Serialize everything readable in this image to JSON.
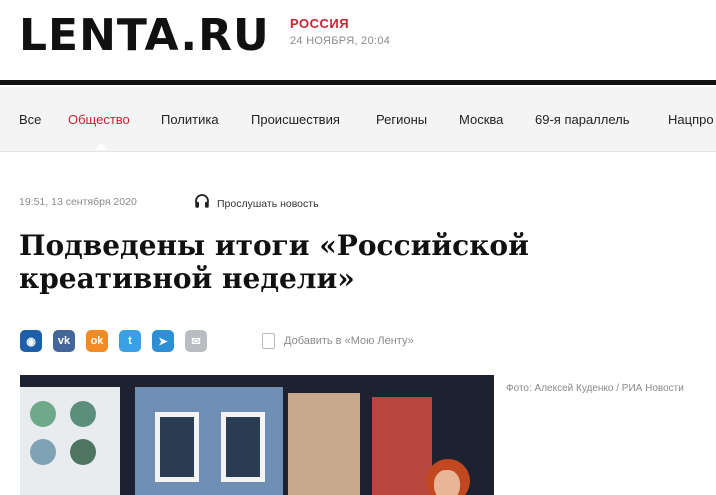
{
  "header": {
    "logo": "LENTA.RU",
    "rubric": "РОССИЯ",
    "datetime": "24 НОЯБРЯ, 20:04"
  },
  "nav": {
    "items": [
      {
        "label": "Все",
        "active": false
      },
      {
        "label": "Общество",
        "active": true
      },
      {
        "label": "Политика",
        "active": false
      },
      {
        "label": "Происшествия",
        "active": false
      },
      {
        "label": "Регионы",
        "active": false
      },
      {
        "label": "Москва",
        "active": false
      },
      {
        "label": "69-я параллель",
        "active": false
      },
      {
        "label": "Нацпро",
        "active": false
      }
    ]
  },
  "article": {
    "published": "19:51, 13 сентября 2020",
    "listen_label": "Прослушать новость",
    "title": "Подведены итоги «Российской креативной недели»",
    "add_to_feed_label": "Добавить в «Мою Ленту»",
    "photo_caption": "Фото: Алексей Куденко / РИА Новости"
  },
  "share_buttons": [
    {
      "name": "odnoklassniki-circle",
      "icon": "circle-icon",
      "glyph": "◉",
      "color": "#1d5fa8"
    },
    {
      "name": "vk",
      "icon": "vk-icon",
      "glyph": "vk",
      "color": "#44679a"
    },
    {
      "name": "ok",
      "icon": "ok-icon",
      "glyph": "ok",
      "color": "#f28b24"
    },
    {
      "name": "twitter",
      "icon": "twitter-icon",
      "glyph": "t",
      "color": "#3aa0e6"
    },
    {
      "name": "telegram",
      "icon": "telegram-icon",
      "glyph": "➤",
      "color": "#2d8fd4"
    },
    {
      "name": "email",
      "icon": "mail-icon",
      "glyph": "✉",
      "color": "#b9bdc2"
    }
  ],
  "colors": {
    "accent": "#cc2233",
    "text": "#111111",
    "muted": "#8a8a8a",
    "nav_background": "#f4f4f4"
  }
}
